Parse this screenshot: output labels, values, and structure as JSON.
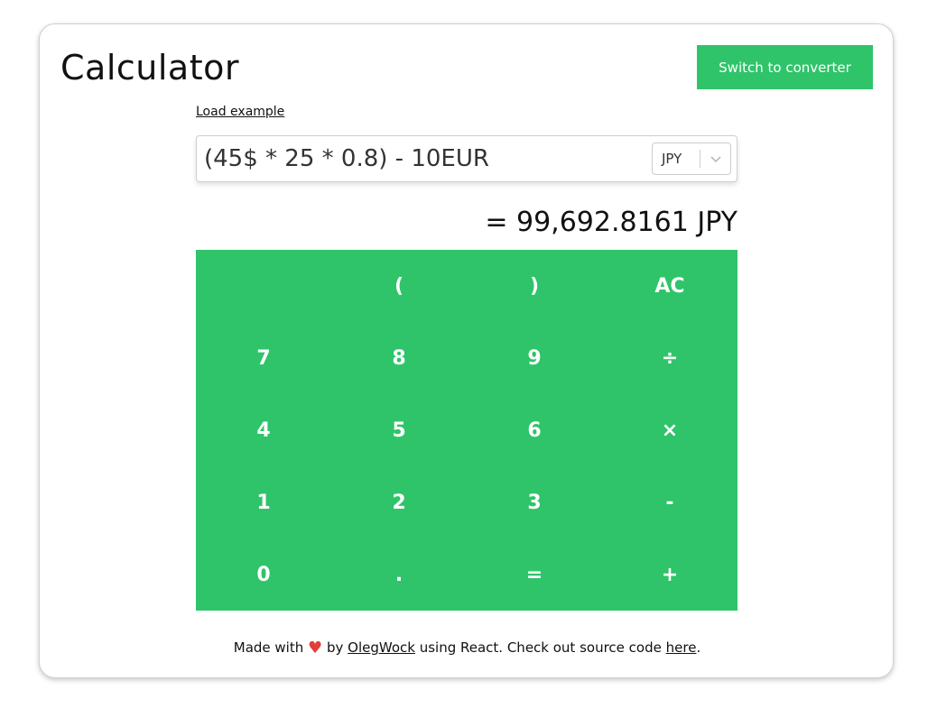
{
  "header": {
    "title": "Calculator",
    "switch_label": "Switch to converter"
  },
  "load_example_label": "Load example",
  "expression": {
    "value": "(45$ * 25 * 0.8) - 10EUR"
  },
  "currency": {
    "selected": "JPY"
  },
  "result": "= 99,692.8161 JPY",
  "keypad": {
    "rows": [
      [
        "",
        "(",
        ")",
        "AC"
      ],
      [
        "7",
        "8",
        "9",
        "÷"
      ],
      [
        "4",
        "5",
        "6",
        "×"
      ],
      [
        "1",
        "2",
        "3",
        "-"
      ],
      [
        "0",
        ".",
        "=",
        "+"
      ]
    ]
  },
  "footer": {
    "made_with": "Made with",
    "by": "by",
    "author": "OlegWock",
    "using": "using React. Check out source code",
    "here": "here",
    "period": "."
  },
  "colors": {
    "accent": "#2fc46a",
    "heart": "#e0403a"
  },
  "icons": {
    "heart": "heart-icon",
    "chevron": "chevron-down-icon"
  }
}
